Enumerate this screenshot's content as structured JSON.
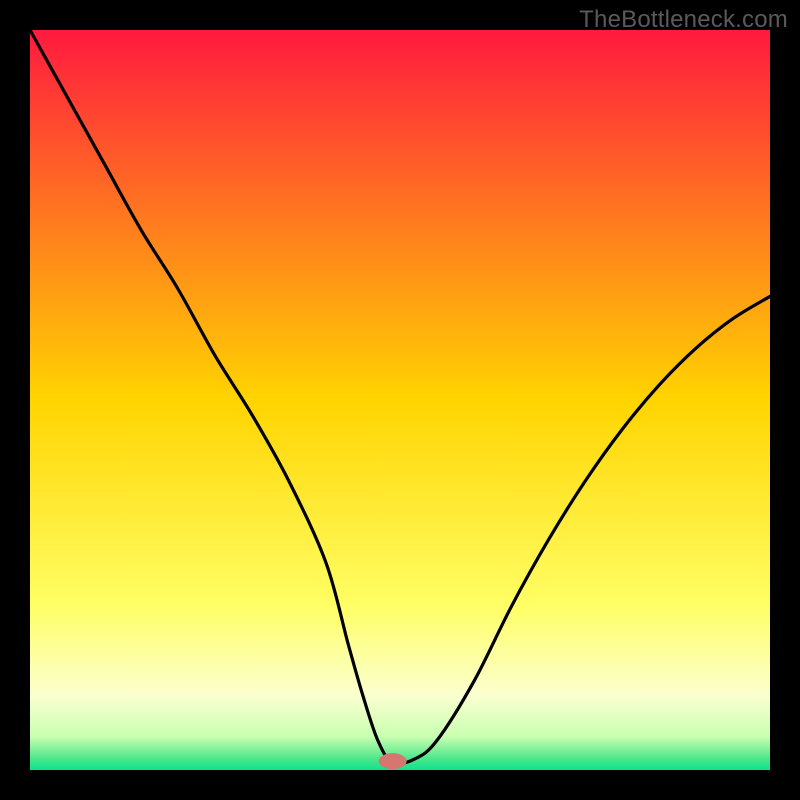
{
  "watermark": "TheBottleneck.com",
  "chart_data": {
    "type": "line",
    "title": "",
    "xlabel": "",
    "ylabel": "",
    "xlim": [
      0,
      100
    ],
    "ylim": [
      0,
      100
    ],
    "background_gradient": {
      "stops": [
        {
          "offset": 0.0,
          "color": "#ff1a3f"
        },
        {
          "offset": 0.5,
          "color": "#ffd400"
        },
        {
          "offset": 0.78,
          "color": "#ffff66"
        },
        {
          "offset": 0.9,
          "color": "#fbffd0"
        },
        {
          "offset": 0.955,
          "color": "#c8ffb0"
        },
        {
          "offset": 0.985,
          "color": "#4ce68a"
        },
        {
          "offset": 1.0,
          "color": "#0be38f"
        }
      ]
    },
    "series": [
      {
        "name": "bottleneck-curve",
        "color": "#000000",
        "x": [
          0,
          5,
          10,
          15,
          20,
          25,
          30,
          35,
          40,
          43,
          45,
          47,
          49,
          52,
          55,
          60,
          65,
          70,
          75,
          80,
          85,
          90,
          95,
          100
        ],
        "values": [
          100,
          91,
          82,
          73,
          65,
          56,
          48,
          39,
          28,
          17,
          10,
          4,
          1,
          1.5,
          4,
          12,
          22,
          31,
          39,
          46,
          52,
          57,
          61,
          64
        ]
      }
    ],
    "marker": {
      "name": "target-point",
      "x": 49,
      "y": 1.2,
      "color": "#d6776f",
      "rx": 14,
      "ry": 8
    }
  }
}
